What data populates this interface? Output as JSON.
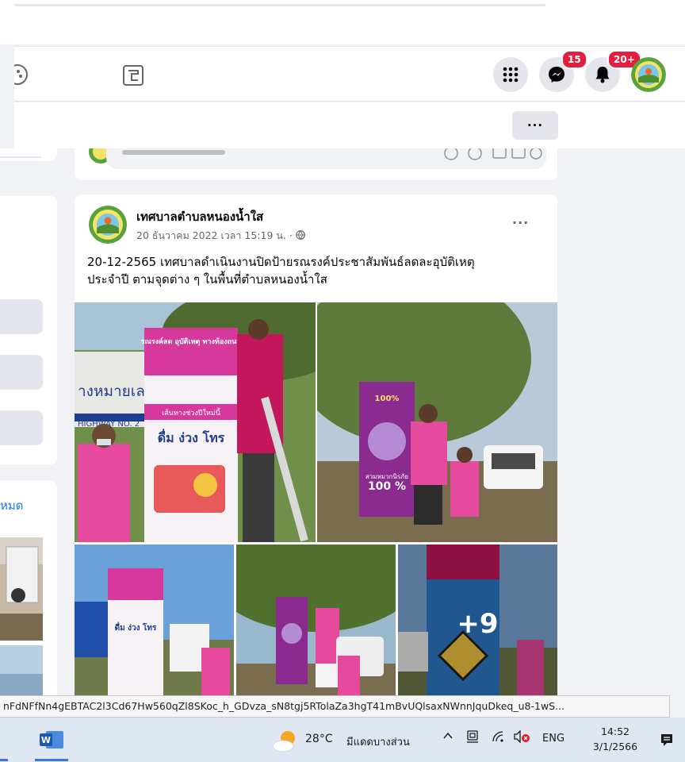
{
  "header": {
    "messenger_badge": "15",
    "notifications_badge": "20+",
    "more_label": "···"
  },
  "left_column": {
    "see_all_fragment": "หมด"
  },
  "post": {
    "author": "เทศบาลตำบลหนองน้ำใส",
    "timestamp": "20 ธันวาคม 2022 เวลา 15:19 น. ·",
    "text_line1": "20-12-2565 เทศบาลดำเนินงานปิดป้ายรณรงค์ประชาสัมพันธ์ลดละอุบัติเหตุ",
    "text_line2": "ประจำปี ตามจุดต่าง ๆ ในพื้นที่ตำบลหนองน้ำใส",
    "options_label": "···",
    "more_photos_label": "+9",
    "sign_text": {
      "sign1_top": "รณรงค์ลด อุบัติเหตุ ทางท้องถนน",
      "sign1_mid": "เส้นทางช่วงปีใหม่นี้",
      "sign1_words": "ดื่ม ง่วง โทร",
      "road_sign": "HIGHWAY NO. 2",
      "road_sign_thai": "างหมายเลข 2",
      "sign2_pct": "100 %",
      "sign2_caption": "สวมหมวกนิรภัย"
    }
  },
  "url_status": "nFdNFfNn4gEBTAC2l3Cd67Hw560qZl8SKoc_h_GDvza_sN8tgj5RTolaZa3hgT41mBvUQlsaxNWnnJquDkeq_u8-1wS...",
  "taskbar": {
    "weather_temp": "28°C",
    "weather_desc": "มีแดดบางส่วน",
    "language": "ENG",
    "time": "14:52",
    "date": "3/1/2566",
    "colors": {
      "accent": "#3b78d8",
      "taskbar_bg": "#dfe7f2"
    }
  },
  "colors": {
    "fb_blue": "#1877f2",
    "badge_red": "#e41e3f",
    "page_bg": "#f0f2f5",
    "sign_pink": "#d6399b"
  }
}
